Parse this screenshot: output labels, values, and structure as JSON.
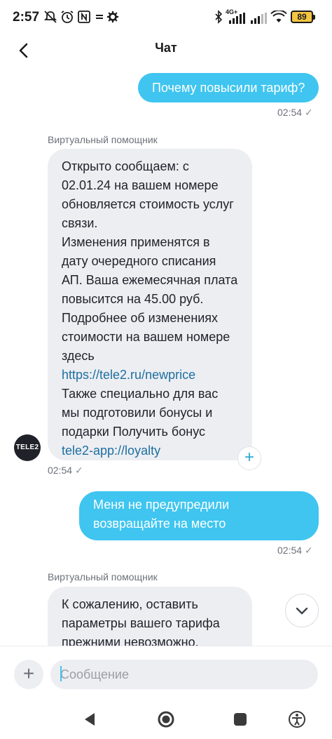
{
  "status_bar": {
    "time": "2:57",
    "network": "4G+",
    "battery": "89",
    "battery_color": "#f5c542",
    "left_icons": [
      "mute-icon",
      "alarm-icon",
      "nfc-icon",
      "tasks-icon",
      "settings-gear-icon"
    ],
    "right_icons": [
      "bluetooth-icon",
      "signal-icon",
      "signal-icon",
      "wifi-icon",
      "battery-icon"
    ]
  },
  "header": {
    "title": "Чат",
    "back_icon": "back-arrow-icon"
  },
  "colors": {
    "outgoing_bubble": "#3fc5f0",
    "incoming_bubble": "#eceef2",
    "link": "#1e6fa0"
  },
  "messages": [
    {
      "direction": "out",
      "lines": [
        "Почему повысили тариф?"
      ],
      "time": "02:54",
      "status": "read"
    },
    {
      "direction": "in",
      "sender": "Виртуальный помощник",
      "avatar": "TELE2",
      "lines": [
        "Открыто сообщаем: с",
        "02.01.24 на вашем номере",
        "обновляется стоимость услуг",
        "связи.",
        "Изменения применятся в",
        "дату очередного списания",
        "АП. Ваша ежемесячная плата",
        "повысится на 45.00 руб.",
        "Подробнее об изменениях",
        "стоимости на вашем номере",
        "здесь",
        "https://tele2.ru/newprice",
        "Также специально для вас",
        "мы подготовили бонусы и",
        "подарки Получить бонус",
        "tele2-app://loyalty"
      ],
      "time": "02:54",
      "status": "read"
    },
    {
      "direction": "out",
      "lines": [
        "Меня не предупредили",
        "возвращайте на место"
      ],
      "time": "02:54",
      "status": "read"
    },
    {
      "direction": "in",
      "sender": "Виртуальный помощник",
      "lines": [
        "К сожалению, оставить",
        "параметры вашего тарифа",
        "прежними невозможно,"
      ]
    }
  ],
  "composer": {
    "placeholder": "Сообщение",
    "attach_icon": "plus-icon"
  },
  "nav_icons": [
    "back-triangle-icon",
    "home-circle-icon",
    "recents-square-icon",
    "accessibility-icon"
  ]
}
